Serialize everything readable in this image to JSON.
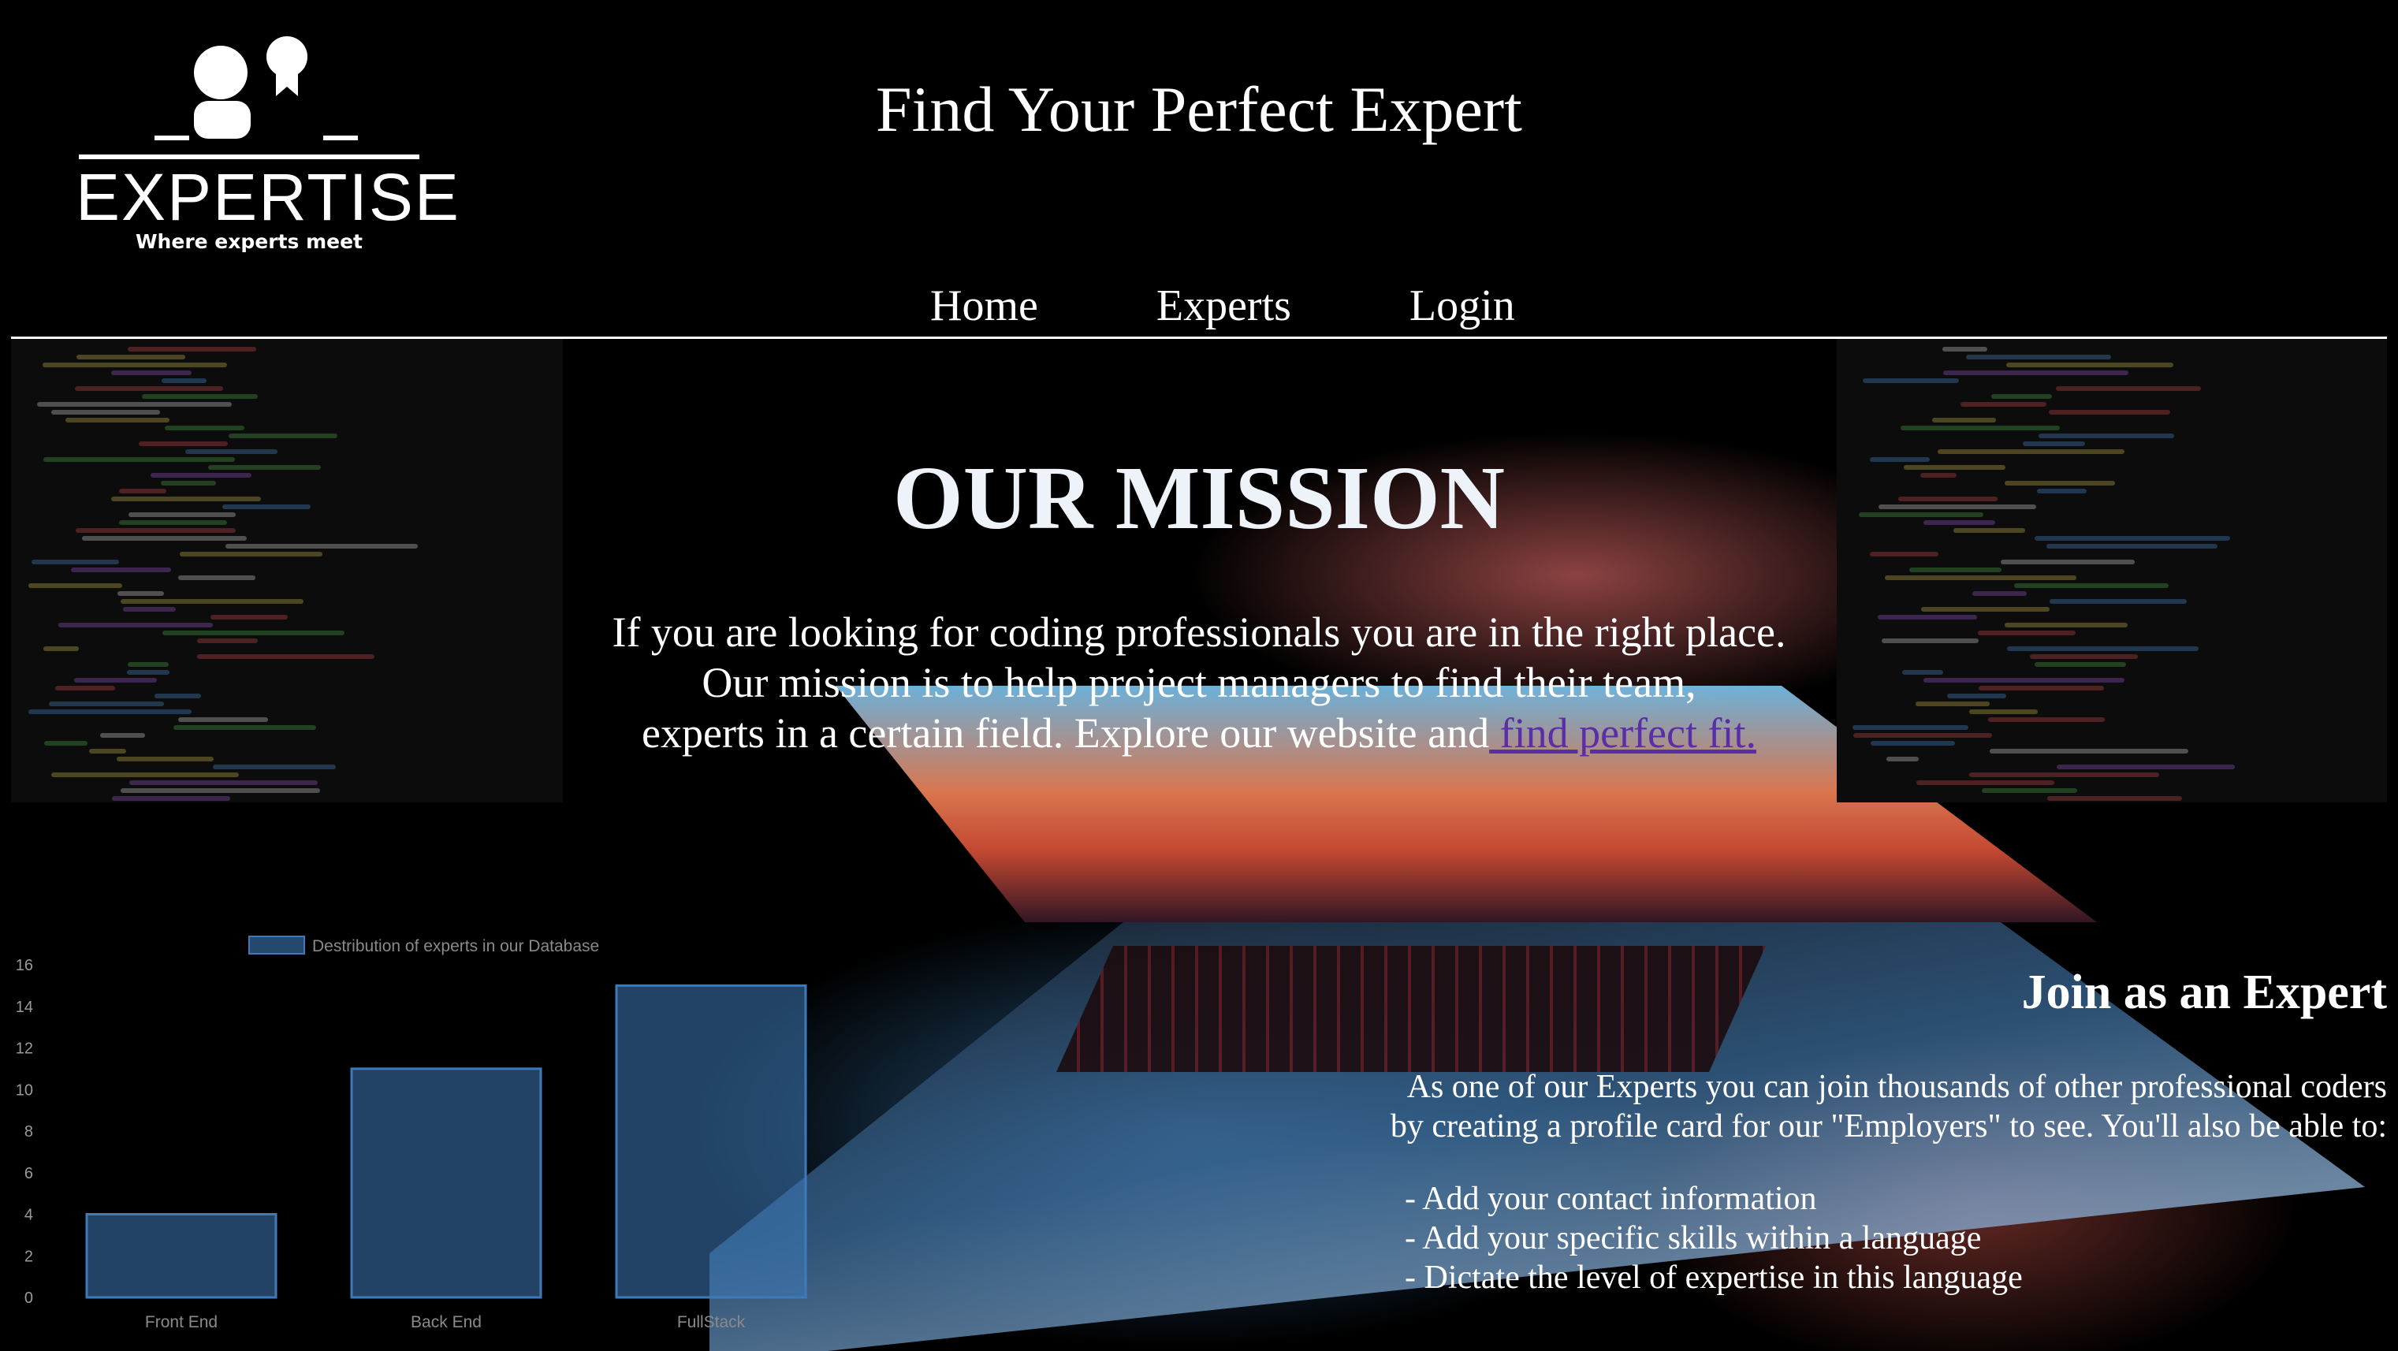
{
  "header": {
    "logo": {
      "word": "EXPERTISE",
      "tagline": "Where experts meet",
      "icon": "person-with-badge-icon"
    },
    "title": "Find Your Perfect Expert",
    "nav": [
      {
        "label": "Home"
      },
      {
        "label": "Experts"
      },
      {
        "label": "Login"
      }
    ]
  },
  "mission": {
    "title": "OUR MISSION",
    "line1": "If you are looking for coding professionals you are in the right place.",
    "line2": "Our mission is to help project managers to find their team,",
    "line3": "experts in a certain field. Explore our website and",
    "link": " find perfect fit."
  },
  "chart_data": {
    "type": "bar",
    "categories": [
      "Front End",
      "Back End",
      "FullStack"
    ],
    "series": [
      {
        "name": "Destribution  of experts in our Database",
        "values": [
          4,
          11,
          15
        ],
        "color": "#3e7ab8"
      }
    ],
    "ylim": [
      0,
      16
    ],
    "yticks": [
      0,
      2,
      4,
      6,
      8,
      10,
      12,
      14,
      16
    ],
    "legend": "top",
    "grid": false
  },
  "join": {
    "title": "Join as an Expert",
    "intro1": "As one of our Experts you can join thousands of other professional coders",
    "intro2": "by creating a profile card for our \"Employers\" to see. You'll also be able to:",
    "items": [
      "- Add your contact information",
      "- Add your specific skills within a language",
      "- Dictate the level of expertise in this language"
    ]
  },
  "colors": {
    "link": "#5a2ea6",
    "bar": "#3e7ab8",
    "background": "#000000"
  }
}
